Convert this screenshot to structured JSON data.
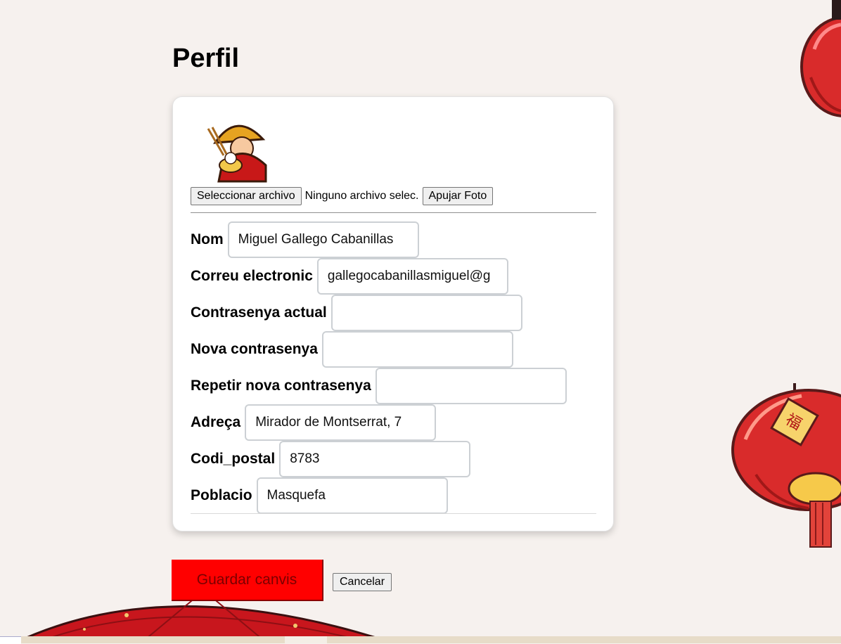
{
  "page": {
    "title": "Perfil"
  },
  "photo": {
    "choose_file_label": "Seleccionar archivo",
    "no_file_text": "Ninguno archivo selec.",
    "upload_label": "Apujar Foto"
  },
  "fields": [
    {
      "label": "Nom",
      "value": "Miguel Gallego Cabanillas"
    },
    {
      "label": "Correu electronic",
      "value": "gallegocabanillasmiguel@g"
    },
    {
      "label": "Contrasenya actual",
      "value": ""
    },
    {
      "label": "Nova contrasenya",
      "value": ""
    },
    {
      "label": "Repetir nova contrasenya",
      "value": ""
    },
    {
      "label": "Adreça",
      "value": "Mirador de Montserrat, 7"
    },
    {
      "label": "Codi_postal",
      "value": "8783"
    },
    {
      "label": "Poblacio",
      "value": "Masquefa"
    }
  ],
  "actions": {
    "save_label": "Guardar canvis",
    "cancel_label": "Cancelar"
  },
  "colors": {
    "save_button": "#ff0000",
    "background": "#f6f1ee",
    "lantern": "#d92b2b"
  },
  "icons": [
    "lantern-icon",
    "umbrella-icon",
    "chef-avatar"
  ]
}
